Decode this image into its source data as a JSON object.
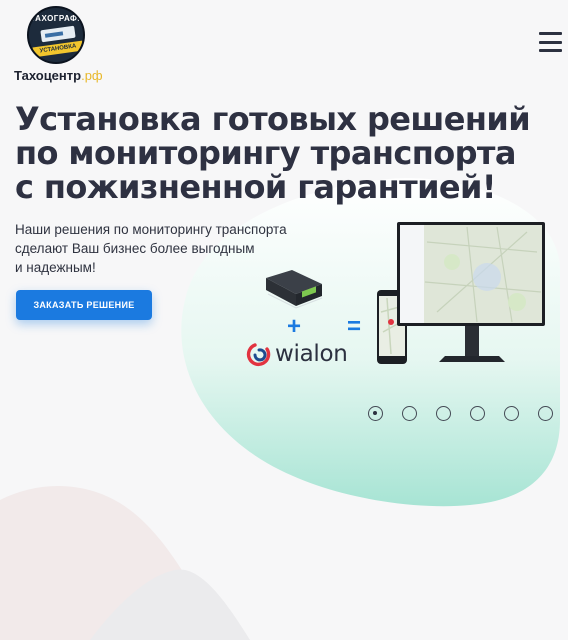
{
  "header": {
    "logo_top_text": "ТАХОГРАФЫ",
    "logo_bottom_text": "УСТАНОВКА",
    "brand_name": "Тахоцентр",
    "brand_tld": ".рф",
    "menu_icon": "hamburger-menu-icon"
  },
  "hero": {
    "title_lines": [
      "Установка готовых решений",
      "по мониторингу транспорта",
      "с пожизненной гарантией!"
    ],
    "subtitle_lines": [
      "Наши решения по мониторингу транспорта",
      "сделают Ваш бизнес более выгодным",
      "и надежным!"
    ],
    "cta_label": "ЗАКАЗАТЬ РЕШЕНИЕ"
  },
  "illustration": {
    "plus_sign": "+",
    "equals_sign": "=",
    "wialon_label": "wialon",
    "device_icon": "gps-tracker-icon",
    "monitor_icon": "monitor-map-icon",
    "phone_icon": "smartphone-map-icon"
  },
  "slider": {
    "dot_count": 6,
    "active_index": 0
  },
  "colors": {
    "accent": "#1b7ae0",
    "blob_top": "#ffffff",
    "blob_bottom": "#a7e4d4",
    "title": "#2e3142",
    "brand_tld": "#e8b82a",
    "background": "#f7f7f8"
  }
}
